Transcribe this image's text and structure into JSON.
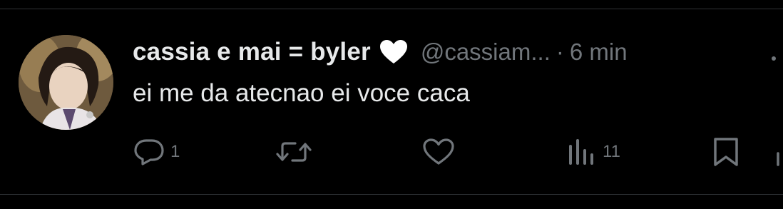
{
  "tweet": {
    "display_name": "cassia e mai = byler",
    "name_emoji": "white-heart",
    "handle": "@cassiam...",
    "separator": "·",
    "time": "6 min",
    "text": "ei me da atecnao ei voce caca"
  },
  "actions": {
    "reply": {
      "icon": "reply-icon",
      "count": "1"
    },
    "repost": {
      "icon": "repost-icon",
      "count": ""
    },
    "like": {
      "icon": "heart-icon",
      "count": ""
    },
    "views": {
      "icon": "views-icon",
      "count": "11"
    },
    "bookmark": {
      "icon": "bookmark-icon"
    },
    "share": {
      "icon": "share-icon"
    }
  },
  "colors": {
    "background": "#000000",
    "primary_text": "#e7e9ea",
    "secondary_text": "#71767b",
    "divider": "#2f3336"
  }
}
